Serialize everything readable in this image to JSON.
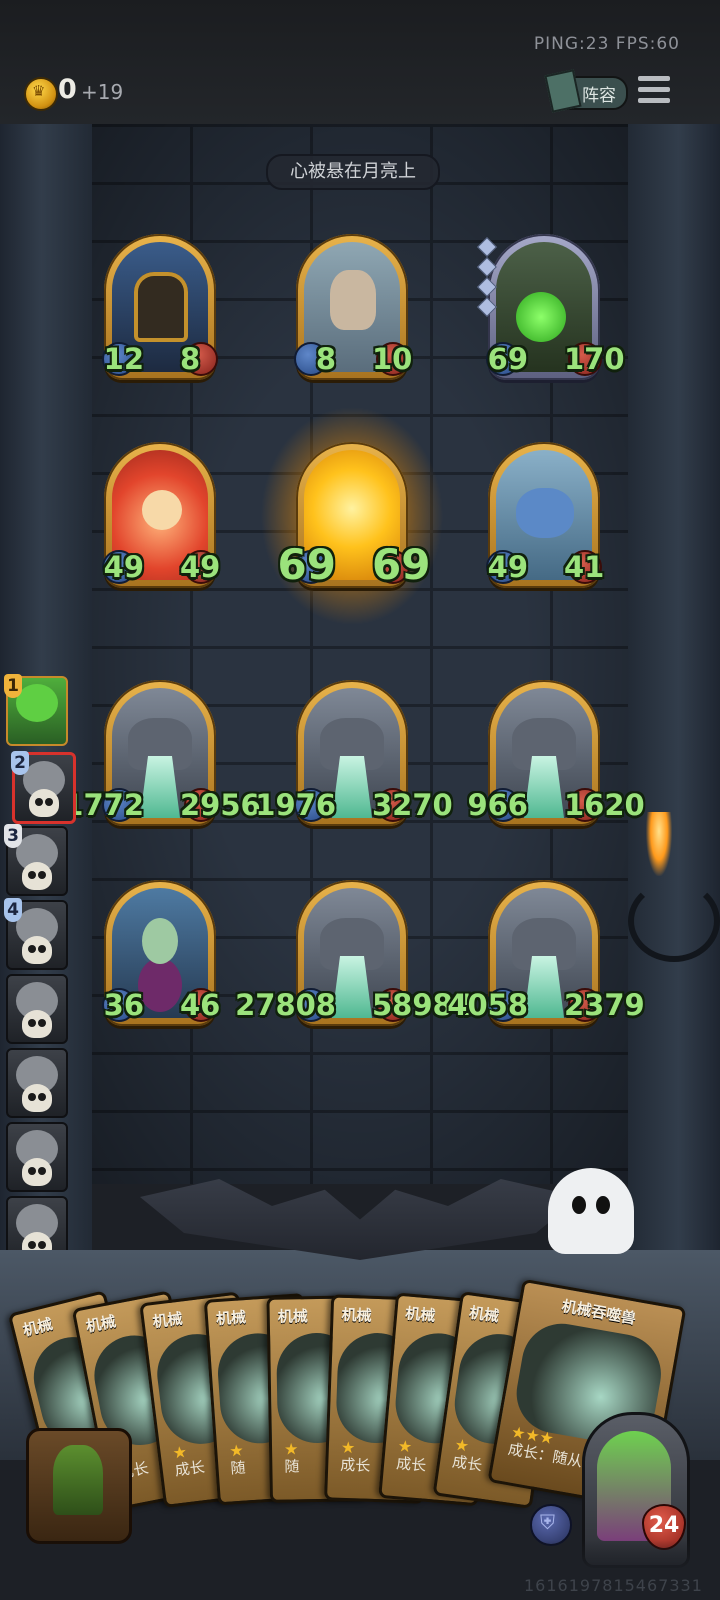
{
  "header": {
    "ping_label": "PING:23   FPS:60",
    "gold": "0",
    "gold_income": "+19",
    "lineup_button": "阵容",
    "icons": {
      "coin": "crown-coin-icon",
      "menu": "hamburger-menu-icon",
      "lineup": "book-icon"
    }
  },
  "quest_banner": "心被悬在月亮上",
  "board": {
    "rows": [
      [
        {
          "name": "knight",
          "attack": "12",
          "health": "8",
          "frame": "gold"
        },
        {
          "name": "owl-beast",
          "attack": "8",
          "health": "10",
          "frame": "gold"
        },
        {
          "name": "green-dragon",
          "attack": "69",
          "health": "170",
          "frame": "silver"
        }
      ],
      [
        {
          "name": "red-dragonling",
          "attack": "49",
          "health": "49",
          "frame": "gold"
        },
        {
          "name": "golden-minion",
          "attack": "69",
          "health": "69",
          "frame": "gold"
        },
        {
          "name": "blue-dragonling",
          "attack": "49",
          "health": "41",
          "frame": "gold"
        }
      ],
      [
        {
          "name": "mech-devourer-1",
          "attack": "1772",
          "health": "2956",
          "frame": "gold"
        },
        {
          "name": "mech-devourer-2",
          "attack": "1976",
          "health": "3270",
          "frame": "gold"
        },
        {
          "name": "mech-devourer-3",
          "attack": "966",
          "health": "1620",
          "frame": "gold"
        }
      ],
      [
        {
          "name": "elf-witch",
          "attack": "36",
          "health": "46",
          "frame": "gold"
        },
        {
          "name": "mech-devourer-4",
          "attack": "27808",
          "health": "58984",
          "frame": "gold"
        },
        {
          "name": "mech-devourer-5",
          "attack": "4058",
          "health": "2379",
          "frame": "gold"
        }
      ]
    ]
  },
  "player_list": [
    {
      "rank": "1",
      "state": "active"
    },
    {
      "rank": "2",
      "state": "selected"
    },
    {
      "rank": "3",
      "state": "dead"
    },
    {
      "rank": "4",
      "state": "dead"
    },
    {
      "rank": "",
      "state": "dead"
    },
    {
      "rank": "",
      "state": "dead"
    },
    {
      "rank": "",
      "state": "dead"
    },
    {
      "rank": "",
      "state": "dead"
    }
  ],
  "hand": {
    "cards": [
      {
        "title": "机械",
        "text": "成长"
      },
      {
        "title": "机械",
        "text": "成长"
      },
      {
        "title": "机械",
        "text": "成长"
      },
      {
        "title": "机械",
        "text": "随"
      },
      {
        "title": "机械",
        "text": "随"
      },
      {
        "title": "机械",
        "text": "成长"
      },
      {
        "title": "机械",
        "text": "成长"
      },
      {
        "title": "机械",
        "text": "成长"
      },
      {
        "title": "机械吞噬兽",
        "text": "成长：随从，"
      }
    ]
  },
  "hero": {
    "health": "24"
  },
  "game_id": "1616197815467331"
}
